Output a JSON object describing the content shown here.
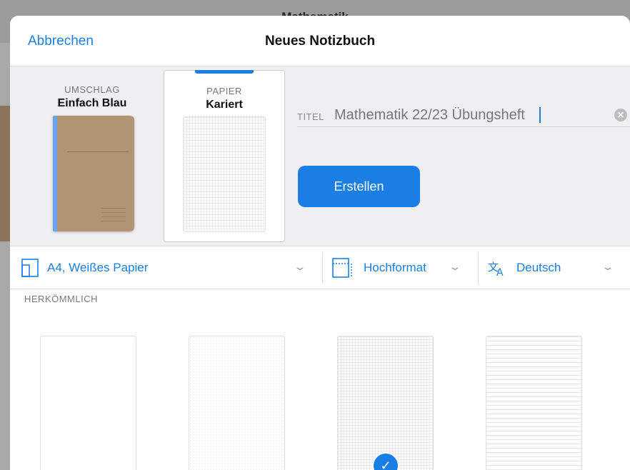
{
  "background": {
    "title": "Mathematik"
  },
  "nav": {
    "cancel": "Abbrechen",
    "title": "Neues Notizbuch"
  },
  "cover": {
    "caption": "UMSCHLAG",
    "name": "Einfach Blau"
  },
  "paper": {
    "caption": "PAPIER",
    "name": "Kariert"
  },
  "title_field": {
    "label": "TITEL",
    "value": "Mathematik 22/23 Übungsheft"
  },
  "create_label": "Erstellen",
  "toolbar": {
    "size": "A4, Weißes Papier",
    "orientation": "Hochformat",
    "language": "Deutsch"
  },
  "section_label": "HERKÖMMLICH",
  "templates": [
    "blank",
    "dotted",
    "grid",
    "lined"
  ],
  "colors": {
    "accent": "#1b7ee6",
    "cover": "#b09474",
    "spine": "#6aa3f0"
  }
}
